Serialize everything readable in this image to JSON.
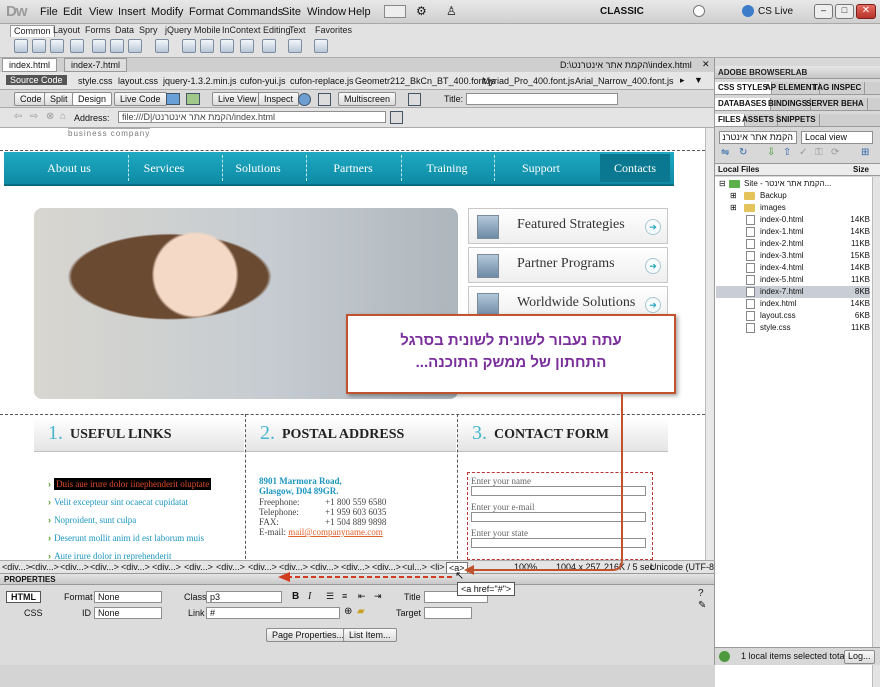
{
  "app": {
    "logo": "Dw",
    "mode": "CLASSIC",
    "cs_live": "CS Live"
  },
  "menu": [
    "File",
    "Edit",
    "View",
    "Insert",
    "Modify",
    "Format",
    "Commands",
    "Site",
    "Window",
    "Help"
  ],
  "insert_tabs": [
    "Common",
    "Layout",
    "Forms",
    "Data",
    "Spry",
    "jQuery Mobile",
    "InContext Editing",
    "Text",
    "Favorites"
  ],
  "doc_tabs": [
    "index.html",
    "index-7.html"
  ],
  "doc_path": "D:\\הקמת אתר אינטרנט\\index.html",
  "related_files": [
    "Source Code",
    "style.css",
    "layout.css",
    "jquery-1.3.2.min.js",
    "cufon-yui.js",
    "cufon-replace.js",
    "Geometr212_BkCn_BT_400.font.js",
    "Myriad_Pro_400.font.js",
    "Arial_Narrow_400.font.js"
  ],
  "view_buttons": [
    "Code",
    "Split",
    "Design",
    "Live Code",
    "Live View",
    "Inspect",
    "Multiscreen"
  ],
  "title_label": "Title:",
  "address_label": "Address:",
  "address_value": "file:///D|/הקמת אתר אינטרנט/index.html",
  "site": {
    "tagline": "business company",
    "nav": [
      "About us",
      "Services",
      "Solutions",
      "Partners",
      "Training",
      "Support",
      "Contacts"
    ],
    "features": [
      "Featured Strategies",
      "Partner Programs",
      "Worldwide Solutions"
    ],
    "columns": [
      {
        "num": "1.",
        "title": "USEFUL LINKS",
        "links": [
          "Duis aue irure dolor iinephenderit oluptate",
          "Velit excepteur sint ocaecat cupidatat",
          "Noproident, sunt culpa",
          "Deserunt mollit anim id est laborum muis",
          "Aute irure dolor in reprehenderit"
        ]
      },
      {
        "num": "2.",
        "title": "POSTAL ADDRESS",
        "street": "8901 Marmora Road,",
        "city": "Glasgow, D04 89GR.",
        "rows": [
          [
            "Freephone:",
            "+1 800 559 6580"
          ],
          [
            "Telephone:",
            "+1 959 603 6035"
          ],
          [
            "FAX:",
            "+1 504 889 9898"
          ]
        ],
        "email_label": "E-mail:",
        "email": "mail@companyname.com"
      },
      {
        "num": "3.",
        "title": "CONTACT FORM",
        "fields": [
          "Enter your name",
          "Enter your e-mail",
          "Enter your state"
        ]
      }
    ]
  },
  "callout": {
    "line1": "עתה נעבור לשונית לשונית בסרגל",
    "line2": "התחתון של ממשק התוכנה..."
  },
  "tagbar": {
    "tags": [
      "<div...>",
      "<div...>",
      "<div...>",
      "<div...>",
      "<div...>",
      "<div...>",
      "<div...>",
      "<div...>",
      "<div...>",
      "<div...>",
      "<div...>",
      "<div...>",
      "<div...>",
      "<div...>",
      "<div...>",
      "<ul...>",
      "<li>",
      "<a>"
    ],
    "zoom": "100%",
    "size": "1004 x 257",
    "file": "216K / 5 sec",
    "encoding": "Unicode (UTF-8"
  },
  "tooltip": "<a href=\"#\">",
  "properties": {
    "title": "PROPERTIES",
    "html": "HTML",
    "css": "CSS",
    "format_label": "Format",
    "format": "None",
    "id_label": "ID",
    "id": "None",
    "class_label": "Class",
    "class": "p3",
    "link_label": "Link",
    "link": "#",
    "title_label": "Title",
    "target_label": "Target",
    "page_props": "Page Properties...",
    "list_item": "List Item..."
  },
  "panel": {
    "browserlab": "ADOBE BROWSERLAB",
    "tabs1": [
      "CSS STYLES",
      "AP ELEMENT",
      "TAG INSPEC"
    ],
    "tabs2": [
      "DATABASES",
      "BINDINGS",
      "SERVER BEHA"
    ],
    "tabs3": [
      "FILES",
      "ASSETS",
      "SNIPPETS"
    ],
    "site_select": "הקמת אתר אינטרנ",
    "view_select": "Local view",
    "col_name": "Local Files",
    "col_size": "Size",
    "root": "Site - הקמת אתר אינטר...",
    "files": [
      [
        "Backup",
        ""
      ],
      [
        "images",
        ""
      ],
      [
        "index-0.html",
        "14KB"
      ],
      [
        "index-1.html",
        "14KB"
      ],
      [
        "index-2.html",
        "11KB"
      ],
      [
        "index-3.html",
        "15KB"
      ],
      [
        "index-4.html",
        "14KB"
      ],
      [
        "index-5.html",
        "11KB"
      ],
      [
        "index-7.html",
        "8KB"
      ],
      [
        "index.html",
        "14KB"
      ],
      [
        "layout.css",
        "6KB"
      ],
      [
        "style.css",
        "11KB"
      ]
    ],
    "status": "1 local items selected tota",
    "log": "Log..."
  }
}
